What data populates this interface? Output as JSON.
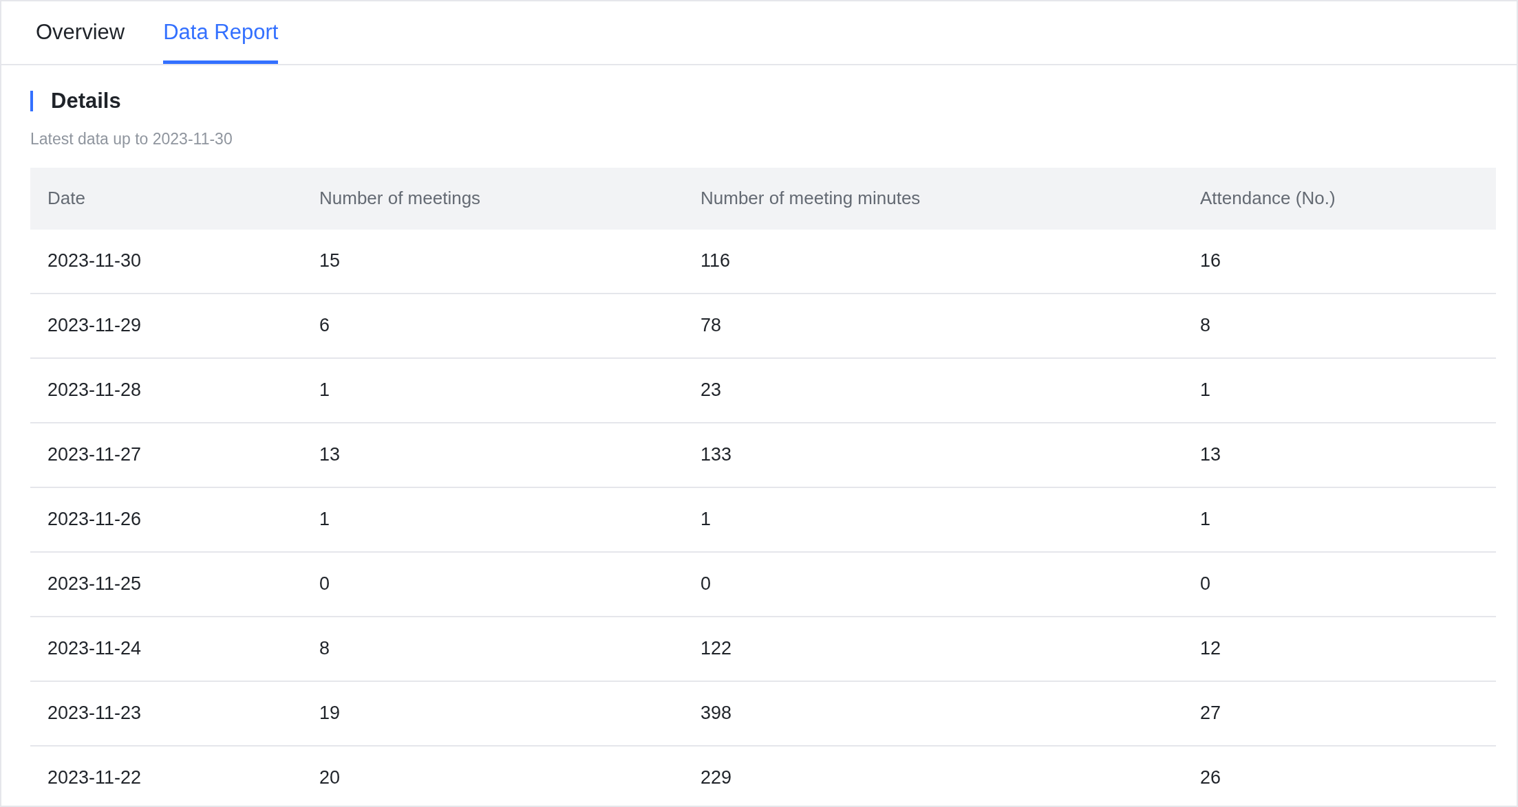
{
  "tabs": [
    {
      "label": "Overview",
      "selected": false
    },
    {
      "label": "Data Report",
      "selected": true
    }
  ],
  "section": {
    "title": "Details",
    "subtitle": "Latest data up to 2023-11-30"
  },
  "table": {
    "columns": [
      "Date",
      "Number of meetings",
      "Number of meeting minutes",
      "Attendance (No.)"
    ],
    "rows": [
      [
        "2023-11-30",
        "15",
        "116",
        "16"
      ],
      [
        "2023-11-29",
        "6",
        "78",
        "8"
      ],
      [
        "2023-11-28",
        "1",
        "23",
        "1"
      ],
      [
        "2023-11-27",
        "13",
        "133",
        "13"
      ],
      [
        "2023-11-26",
        "1",
        "1",
        "1"
      ],
      [
        "2023-11-25",
        "0",
        "0",
        "0"
      ],
      [
        "2023-11-24",
        "8",
        "122",
        "12"
      ],
      [
        "2023-11-23",
        "19",
        "398",
        "27"
      ],
      [
        "2023-11-22",
        "20",
        "229",
        "26"
      ]
    ]
  }
}
